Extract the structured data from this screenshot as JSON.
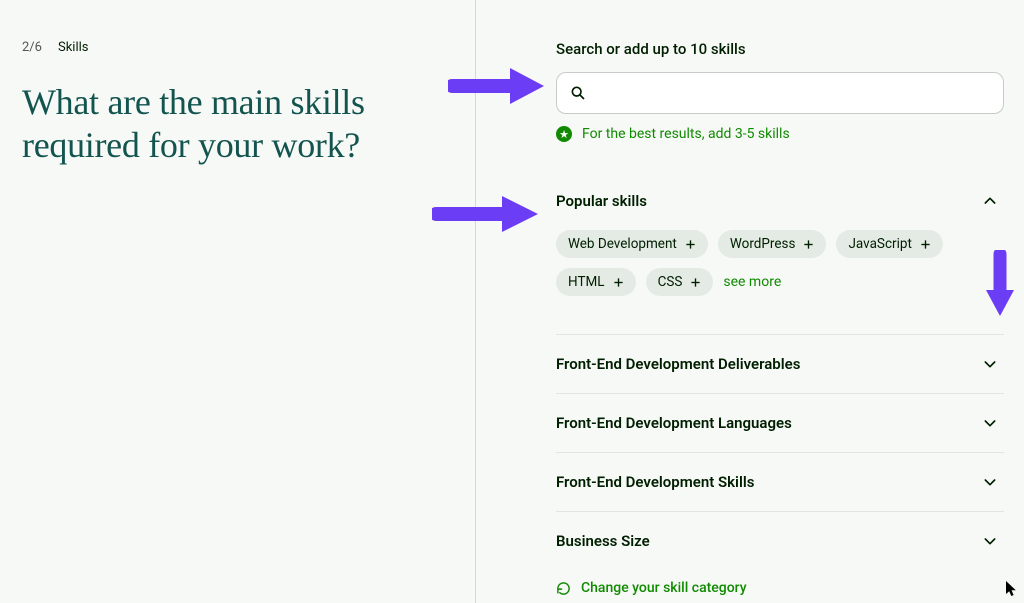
{
  "step": {
    "counter": "2/6",
    "label": "Skills"
  },
  "headline": "What are the main skills required for your work?",
  "search": {
    "label": "Search or add up to 10 skills",
    "placeholder": ""
  },
  "hint": "For the best results, add 3-5 skills",
  "popular": {
    "title": "Popular skills",
    "see_more": "see more",
    "chips": [
      {
        "label": "Web Development"
      },
      {
        "label": "WordPress"
      },
      {
        "label": "JavaScript"
      },
      {
        "label": "HTML"
      },
      {
        "label": "CSS"
      }
    ]
  },
  "categories": [
    {
      "label": "Front-End Development Deliverables"
    },
    {
      "label": "Front-End Development Languages"
    },
    {
      "label": "Front-End Development Skills"
    },
    {
      "label": "Business Size"
    }
  ],
  "change_category": "Change your skill category"
}
